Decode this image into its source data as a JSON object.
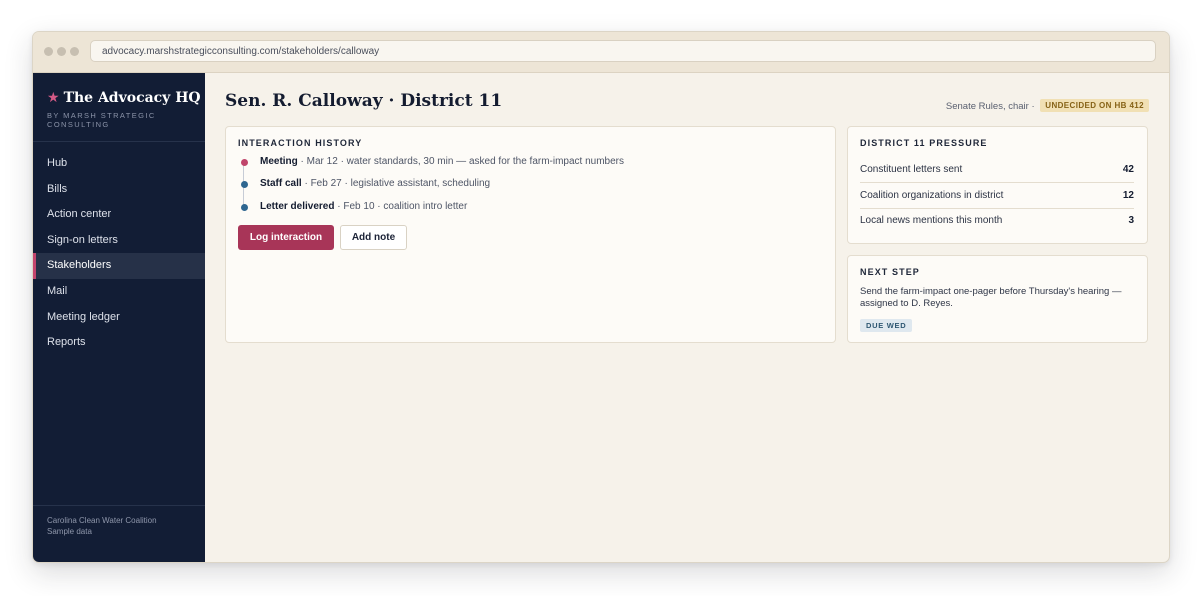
{
  "browser": {
    "url": "advocacy.marshstrategicconsulting.com/stakeholders/calloway"
  },
  "sidebar": {
    "brand_title": "The Advocacy HQ",
    "brand_sub": "By Marsh Strategic Consulting",
    "items": [
      {
        "label": "Hub",
        "active": false
      },
      {
        "label": "Bills",
        "active": false
      },
      {
        "label": "Action center",
        "active": false
      },
      {
        "label": "Sign-on letters",
        "active": false
      },
      {
        "label": "Stakeholders",
        "active": true
      },
      {
        "label": "Mail",
        "active": false
      },
      {
        "label": "Meeting ledger",
        "active": false
      },
      {
        "label": "Reports",
        "active": false
      }
    ],
    "footer_org": "Carolina Clean Water Coalition",
    "footer_note": "Sample data"
  },
  "header": {
    "title": "Sen. R. Calloway · District 11",
    "role": "Senate Rules, chair ·",
    "status_badge": "UNDECIDED ON HB 412"
  },
  "interaction_history": {
    "label": "Interaction History",
    "items": [
      {
        "type": "Meeting",
        "detail": " · Mar 12 · water standards, 30 min — asked for the farm-impact numbers",
        "color": "#c0456b"
      },
      {
        "type": "Staff call",
        "detail": " · Feb 27 · legislative assistant, scheduling",
        "color": "#2e6690"
      },
      {
        "type": "Letter delivered",
        "detail": " · Feb 10 · coalition intro letter",
        "color": "#2e6690"
      }
    ],
    "primary_button": "Log interaction",
    "secondary_button": "Add note"
  },
  "pressure": {
    "label": "District 11 Pressure",
    "rows": [
      {
        "label": "Constituent letters sent",
        "value": "42"
      },
      {
        "label": "Coalition organizations in district",
        "value": "12"
      },
      {
        "label": "Local news mentions this month",
        "value": "3"
      }
    ]
  },
  "next_step": {
    "label": "Next Step",
    "text": "Send the farm-impact one-pager before Thursday's hearing — assigned to D. Reyes.",
    "due": "Due Wed"
  },
  "colors": {
    "accent": "#a83558",
    "sidebar_bg": "#121d35",
    "page_bg": "#f6f2ea"
  }
}
